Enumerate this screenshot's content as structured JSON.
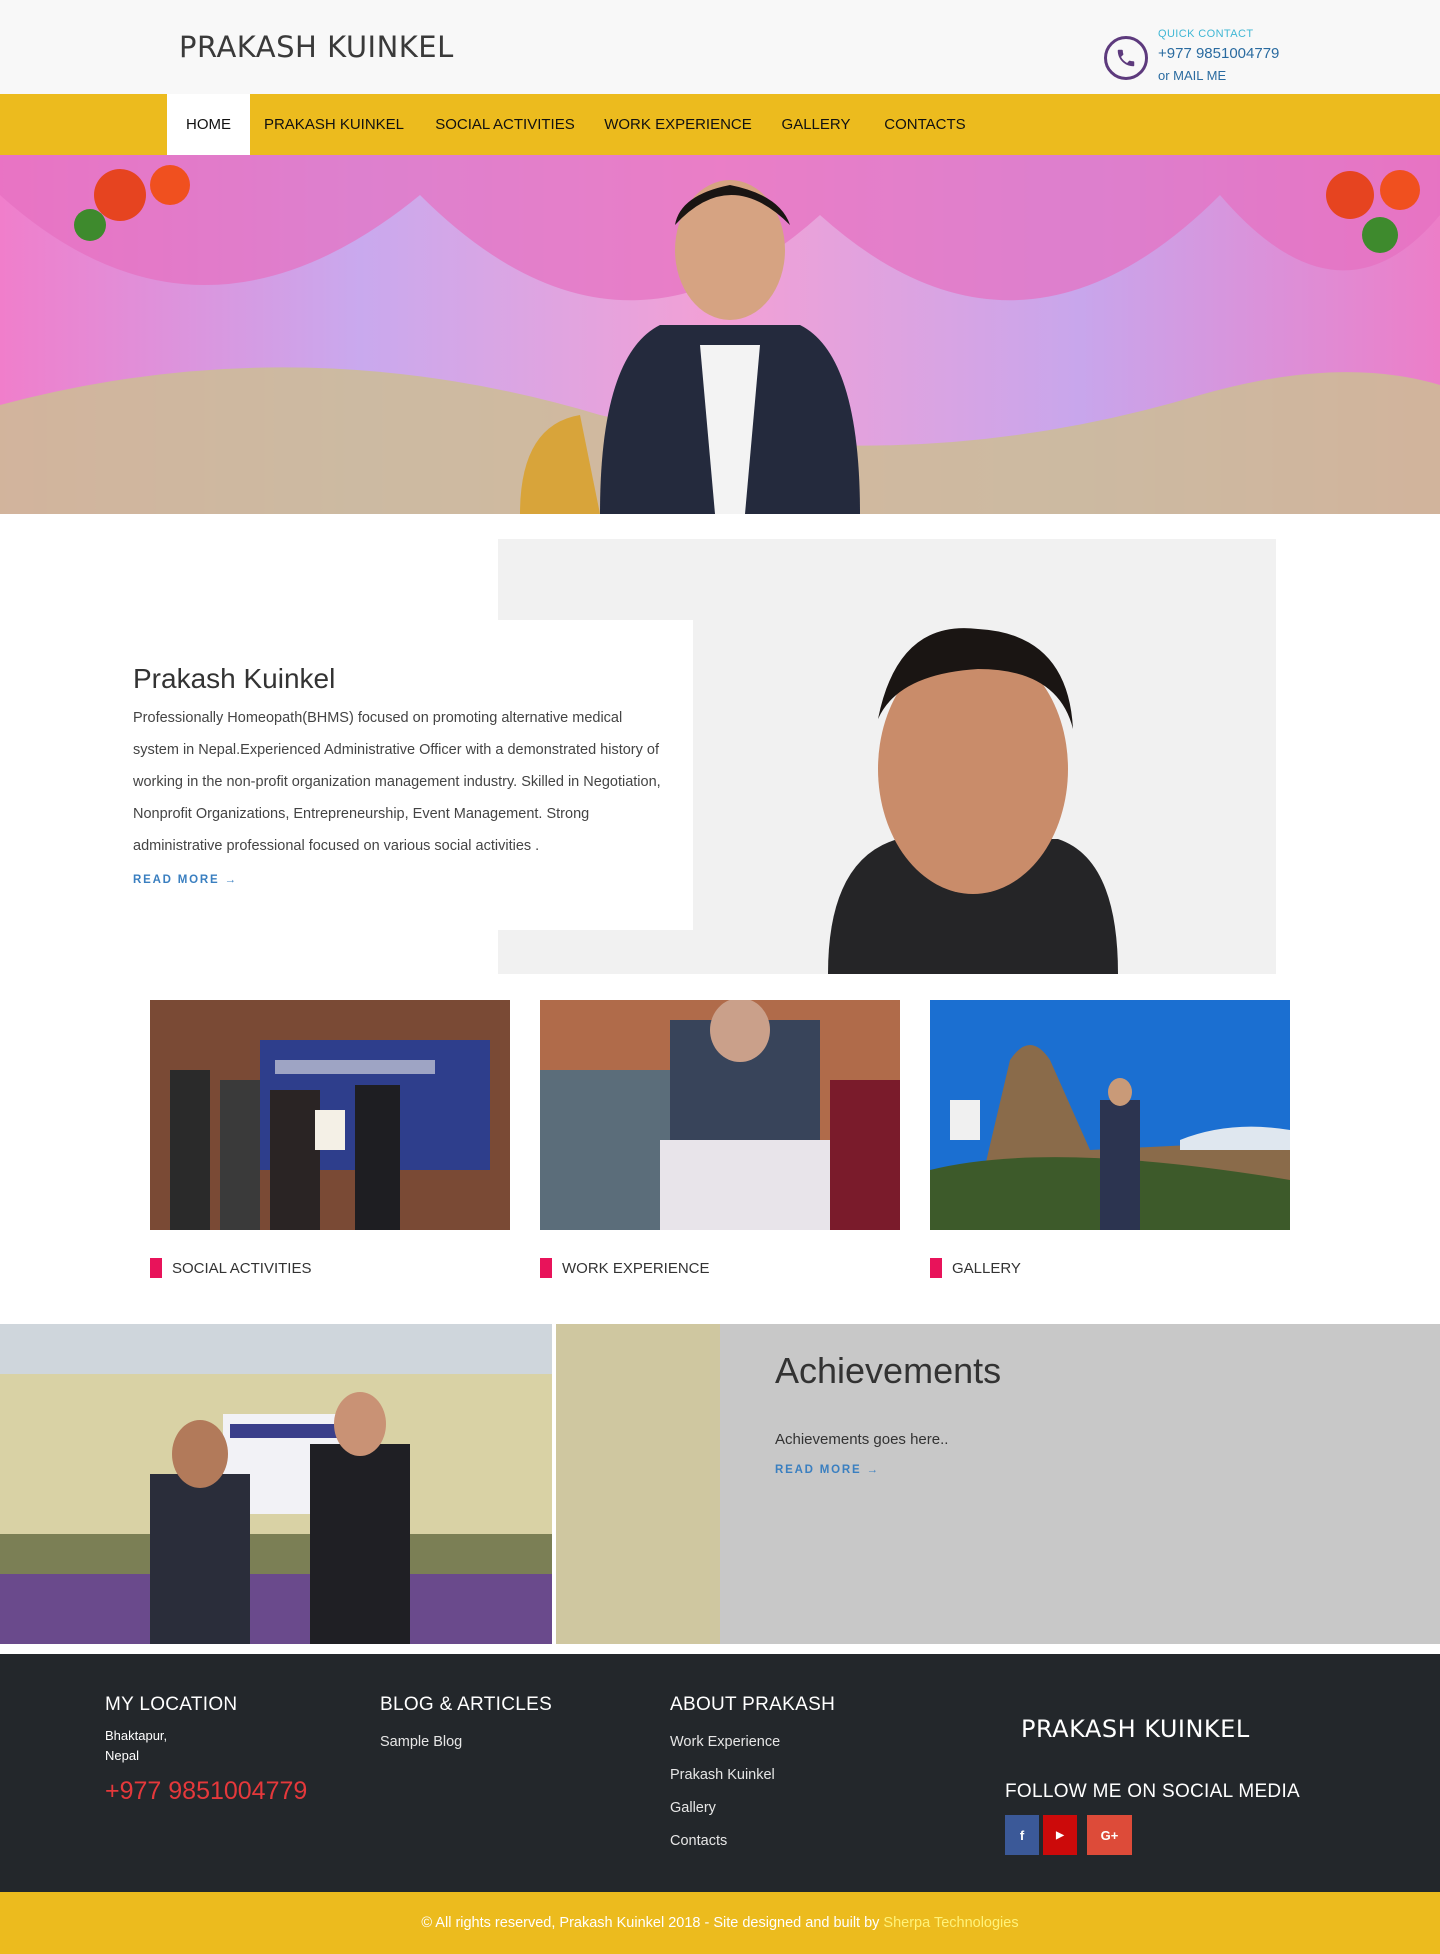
{
  "header": {
    "title": "PRAKASH KUINKEL",
    "quick_contact_label": "QUICK CONTACT",
    "phone": "+977 9851004779",
    "mail": "or MAIL ME"
  },
  "nav": {
    "items": [
      {
        "label": "HOME",
        "active": true
      },
      {
        "label": "PRAKASH KUINKEL",
        "active": false
      },
      {
        "label": "SOCIAL ACTIVITIES",
        "active": false
      },
      {
        "label": "WORK EXPERIENCE",
        "active": false
      },
      {
        "label": "GALLERY",
        "active": false
      },
      {
        "label": "CONTACTS",
        "active": false
      }
    ]
  },
  "about": {
    "name": "Prakash Kuinkel",
    "bio": "Professionally Homeopath(BHMS) focused on promoting alternative medical system in Nepal.Experienced Administrative Officer with a demonstrated history of working in the non-profit organization management industry. Skilled in Negotiation, Nonprofit Organizations,  Entrepreneurship, Event Management. Strong administrative professional focused on various social activities .",
    "read_more": "READ MORE →"
  },
  "cards": [
    {
      "label": "SOCIAL ACTIVITIES"
    },
    {
      "label": "WORK EXPERIENCE"
    },
    {
      "label": "GALLERY"
    }
  ],
  "achievements": {
    "title": "Achievements",
    "text": "Achievements goes here..",
    "read_more": "READ MORE →"
  },
  "footer": {
    "location_heading": "MY LOCATION",
    "location_line1": "Bhaktapur,",
    "location_line2": "Nepal",
    "phone": "+977 9851004779",
    "blog_heading": "BLOG & ARTICLES",
    "blog_links": [
      "Sample Blog"
    ],
    "about_heading": "ABOUT PRAKASH",
    "about_links": [
      "Work Experience",
      "Prakash Kuinkel",
      "Gallery",
      "Contacts"
    ],
    "brand": "PRAKASH KUINKEL",
    "social_heading": "FOLLOW ME ON SOCIAL MEDIA",
    "social": [
      {
        "icon": "facebook-icon",
        "glyph": "f",
        "color": "#3b5998"
      },
      {
        "icon": "youtube-icon",
        "glyph": "▶",
        "color": "#cc0a0a"
      },
      {
        "icon": "google-plus-icon",
        "glyph": "G+",
        "color": "#dd4b39"
      }
    ]
  },
  "bottom_bar": {
    "copyright": "© All rights reserved, Prakash Kuinkel 2018 - Site designed and built by",
    "credit": "Sherpa Technologies"
  },
  "colors": {
    "accent_yellow": "#ecbb1e",
    "card_marker": "#e8135a",
    "link_blue": "#3a7fc0",
    "footer_bg": "#23272b",
    "phone_red": "#e5383b"
  }
}
